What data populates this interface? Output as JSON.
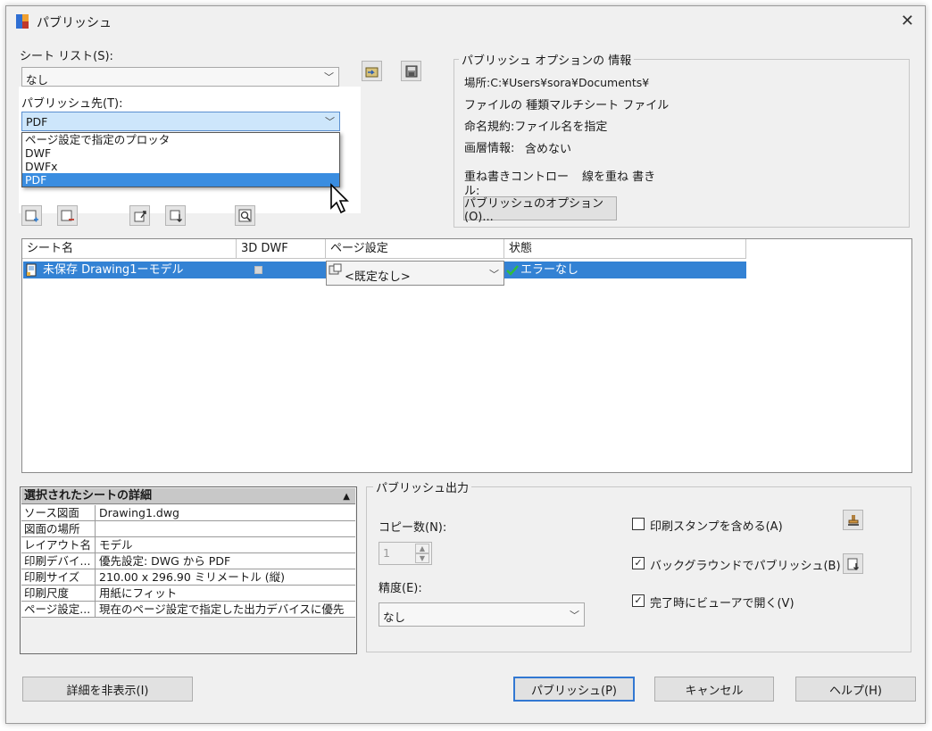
{
  "window": {
    "title": "パブリッシュ",
    "close_glyph": "✕"
  },
  "sheet_list": {
    "label": "シート リスト(S):",
    "selected": "なし"
  },
  "publish_to": {
    "label": "パブリッシュ先(T):",
    "selected": "PDF",
    "options": [
      "ページ設定で指定のプロッタ",
      "DWF",
      "DWFx",
      "PDF"
    ],
    "highlighted_index": 3
  },
  "options_info": {
    "group_title": "パブリッシュ オプションの 情報",
    "location": "場所:C:¥Users¥sora¥Documents¥",
    "file_type": "ファイルの 種類マルチシート ファイル",
    "naming": "命名規約:ファイル名を指定",
    "layer_info_label": "画層情報:",
    "layer_info_value": "含めない",
    "overwrite_label_1": "重ね書きコントロー",
    "overwrite_label_2": "ル:",
    "overwrite_value": "線を重ね 書き",
    "options_button": "パブリッシュのオプション(O)..."
  },
  "sheet_table": {
    "columns": [
      "シート名",
      "3D DWF",
      "ページ設定",
      "状態"
    ],
    "rows": [
      {
        "name": "未保存 Drawing1ーモデル",
        "page_setup": "<既定なし>",
        "status": "エラーなし"
      }
    ]
  },
  "details": {
    "title": "選択されたシートの詳細",
    "rows": [
      {
        "key": "ソース図面",
        "value": "Drawing1.dwg"
      },
      {
        "key": "図面の場所",
        "value": ""
      },
      {
        "key": "レイアウト名",
        "value": "モデル"
      },
      {
        "key": "印刷デバイ...",
        "value": "優先設定: DWG から PDF"
      },
      {
        "key": "印刷サイズ",
        "value": "210.00 x 296.90 ミリメートル (縦)"
      },
      {
        "key": "印刷尺度",
        "value": "用紙にフィット"
      },
      {
        "key": "ページ設定...",
        "value": "現在のページ設定で指定した出力デバイスに優先"
      }
    ]
  },
  "output": {
    "group_title": "パブリッシュ出力",
    "copies_label": "コピー数(N):",
    "copies_value": "1",
    "precision_label": "精度(E):",
    "precision_value": "なし",
    "stamp_label": "印刷スタンプを含める(A)",
    "stamp_checked": false,
    "background_label": "バックグラウンドでパブリッシュ(B)",
    "background_checked": true,
    "viewer_label": "完了時にビューアで開く(V)",
    "viewer_checked": true
  },
  "buttons": {
    "hide_details": "詳細を非表示(I)",
    "publish": "パブリッシュ(P)",
    "cancel": "キャンセル",
    "help": "ヘルプ(H)"
  },
  "colors": {
    "selection": "#3382d4",
    "highlight": "#3a8de0",
    "default_border": "#3278d2"
  }
}
